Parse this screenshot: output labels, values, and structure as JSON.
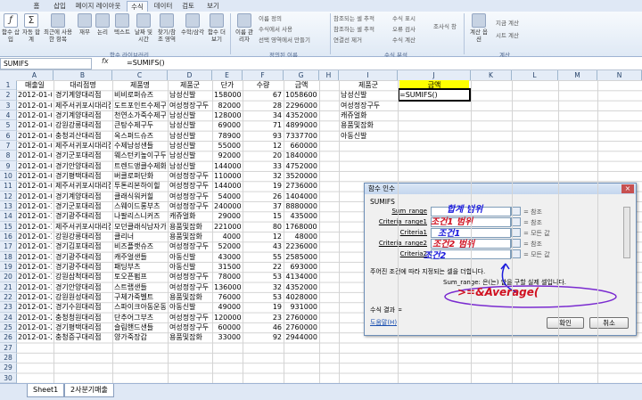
{
  "ribbon": {
    "tabs": [
      "홈",
      "삽입",
      "페이지 레이아웃",
      "수식",
      "데이터",
      "검토",
      "보기"
    ],
    "active_tab": "수식",
    "buttons": [
      {
        "label": "함수 삽입",
        "icon": "fx-icon"
      },
      {
        "label": "자동 합계",
        "icon": "sigma-icon"
      },
      {
        "label": "최근에 사용한 항목",
        "icon": "star-icon"
      },
      {
        "label": "재무",
        "icon": "book-icon"
      },
      {
        "label": "논리",
        "icon": "book-icon"
      },
      {
        "label": "텍스트",
        "icon": "book-icon"
      },
      {
        "label": "날짜 및 시간",
        "icon": "book-icon"
      },
      {
        "label": "찾기/참조 영역",
        "icon": "book-icon"
      },
      {
        "label": "수학/삼각",
        "icon": "book-icon"
      },
      {
        "label": "함수 더 보기",
        "icon": "book-icon"
      },
      {
        "label": "이름 관리자",
        "icon": "tag-icon"
      },
      {
        "label": "계산 옵션",
        "icon": "calc-icon"
      }
    ],
    "small_buttons": [
      "이름 정의",
      "수식에서 사용",
      "선택 영역에서 만들기",
      "참조되는 셀 추적",
      "참조하는 셀 추적",
      "연결선 제거",
      "수식 표시",
      "오류 검사",
      "수식 계산",
      "조사식 창",
      "지금 계산",
      "시트 계산"
    ],
    "groups": [
      "함수 라이브러리",
      "정의된 이름",
      "수식 분석",
      "계산"
    ]
  },
  "formula_bar": {
    "name_box": "SUMIFS",
    "fx": "fx",
    "formula": "=SUMIFS()"
  },
  "columns": [
    "A",
    "B",
    "C",
    "D",
    "E",
    "F",
    "G",
    "H",
    "I",
    "J",
    "K",
    "L",
    "M",
    "N"
  ],
  "headers": [
    "매출일",
    "대리점명",
    "제품명",
    "제품군",
    "단가",
    "수량",
    "금액"
  ],
  "rows": [
    [
      "2012-01-02",
      "경기계양대리점",
      "비비로퍼슈즈",
      "남성신발",
      "158000",
      "67",
      "10586000"
    ],
    [
      "2012-01-02",
      "제주서귀포시대리점",
      "도트포인트수제구두",
      "여성정장구두",
      "82000",
      "28",
      "2296000"
    ],
    [
      "2012-01-03",
      "경기계양대리점",
      "천연소가죽수제구두",
      "남성신발",
      "128000",
      "34",
      "4352000"
    ],
    [
      "2012-01-03",
      "강원강릉대리점",
      "큰탕수제구두",
      "남성신발",
      "69000",
      "71",
      "4899000"
    ],
    [
      "2012-01-04",
      "충청괴산대리점",
      "옥스퍼드슈즈",
      "남성신발",
      "78900",
      "93",
      "7337700"
    ],
    [
      "2012-01-05",
      "제주서귀포시대리점",
      "수제남성샌들",
      "남성신발",
      "55000",
      "12",
      "660000"
    ],
    [
      "2012-01-05",
      "경기군포대리점",
      "웨스턴키높이구두",
      "남성신발",
      "92000",
      "20",
      "1840000"
    ],
    [
      "2012-01-07",
      "경기안양대리점",
      "트렌드앵클수제화",
      "남성신발",
      "144000",
      "33",
      "4752000"
    ],
    [
      "2012-01-08",
      "경기평택대리점",
      "버클로퍼단화",
      "여성정장구두",
      "110000",
      "32",
      "3520000"
    ],
    [
      "2012-01-08",
      "제주서귀포시대리점",
      "투톤리본하이힐",
      "여성정장구두",
      "144000",
      "19",
      "2736000"
    ],
    [
      "2012-01-09",
      "경기계양대리점",
      "클래식워커힐",
      "여성정장구두",
      "54000",
      "26",
      "1404000"
    ],
    [
      "2012-01-11",
      "경기군포대리점",
      "스웨이드롱부츠",
      "여성정장구두",
      "240000",
      "37",
      "8880000"
    ],
    [
      "2012-01-13",
      "경기광주대리점",
      "나팔리스니커즈",
      "캐쥬얼화",
      "29000",
      "15",
      "435000"
    ],
    [
      "2012-01-13",
      "제주서귀포시대리점",
      "모던클래식남자가방",
      "용품및잡화",
      "221000",
      "80",
      "17680000"
    ],
    [
      "2012-01-13",
      "강원강릉대리점",
      "클리너",
      "용품및잡화",
      "4000",
      "12",
      "48000"
    ],
    [
      "2012-01-14",
      "경기김포대리점",
      "비즈플랫슈즈",
      "여성정장구두",
      "52000",
      "43",
      "2236000"
    ],
    [
      "2012-01-16",
      "경기광주대리점",
      "캐주얼샌들",
      "아동신발",
      "43000",
      "55",
      "2585000"
    ],
    [
      "2012-01-17",
      "경기광주대리점",
      "패딩부츠",
      "아동신발",
      "31500",
      "22",
      "693000"
    ],
    [
      "2012-01-17",
      "강원삼척대리점",
      "토오픈펌프",
      "여성정장구두",
      "78000",
      "53",
      "4134000"
    ],
    [
      "2012-01-17",
      "경기안양대리점",
      "스트랩샌들",
      "여성정장구두",
      "136000",
      "32",
      "4352000"
    ],
    [
      "2012-01-23",
      "강원원성대리점",
      "구체가죽벨트",
      "용품및잡화",
      "76000",
      "53",
      "4028000"
    ],
    [
      "2012-01-24",
      "경기수원대리점",
      "스파이크아동운동화",
      "아동신발",
      "49000",
      "19",
      "931000"
    ],
    [
      "2012-01-25",
      "충청청원대리점",
      "단추어그부츠",
      "여성정장구두",
      "120000",
      "23",
      "2760000"
    ],
    [
      "2012-01-26",
      "경기평택대리점",
      "슬림핸드샌들",
      "여성정장구두",
      "60000",
      "46",
      "2760000"
    ],
    [
      "2012-01-27",
      "충청증구대리점",
      "양가죽장갑",
      "용품및잡화",
      "33000",
      "92",
      "2944000"
    ]
  ],
  "summary": {
    "headers": [
      "제품군",
      "금액"
    ],
    "items": [
      "남성신발",
      "여성정장구두",
      "캐쥬얼화",
      "용품및잡화",
      "아동신발"
    ],
    "active_formula": "=SUMIFS()"
  },
  "dialog": {
    "title": "함수 인수",
    "function": "SUMIFS",
    "args": [
      {
        "label": "Sum_range",
        "result": "= 참조"
      },
      {
        "label": "Criteria_range1",
        "result": "= 참조"
      },
      {
        "label": "Criteria1",
        "result": "= 모든 값"
      },
      {
        "label": "Criteria_range2",
        "result": "= 참조"
      },
      {
        "label": "Criteria2",
        "result": "= 모든 값"
      }
    ],
    "description": "주어진 조건에 따라 지정되는 셀을 더합니다.",
    "arg_help": "Sum_range: 은(는) 합을 구할 실제 셀입니다.",
    "result_label": "수식 결과 =",
    "help_link": "도움말(H)",
    "ok": "확인",
    "cancel": "취소",
    "annotations": [
      "합계 범위",
      "조건1 범위",
      "조건1",
      "조건2 범위",
      "조건2",
      ">=&Average("
    ],
    "colors": {
      "ink_blue": "#1a1adc",
      "ink_red": "#d01020"
    }
  },
  "sheet_tabs": [
    "Sheet1",
    "2사분기매출"
  ]
}
